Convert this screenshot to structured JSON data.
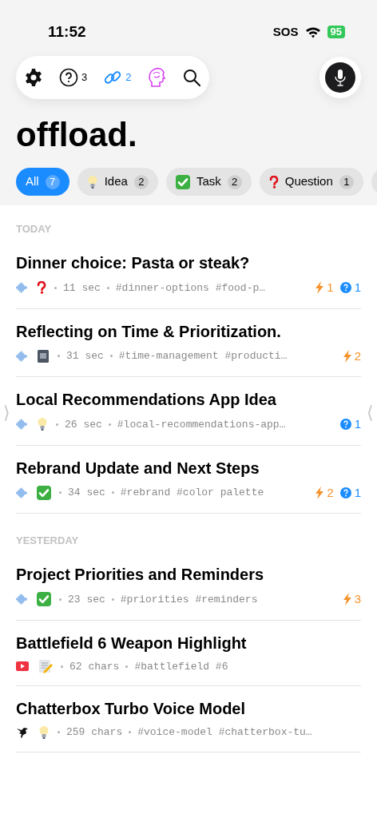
{
  "status_bar": {
    "time": "11:52",
    "carrier": "SOS",
    "battery": "95"
  },
  "toolbar": {
    "questions_count": "3",
    "links_count": "2"
  },
  "app_title": "offload.",
  "filters": [
    {
      "kind": "all",
      "label": "All",
      "count": "7",
      "selected": true
    },
    {
      "kind": "idea",
      "label": "Idea",
      "count": "2",
      "selected": false
    },
    {
      "kind": "task",
      "label": "Task",
      "count": "2",
      "selected": false
    },
    {
      "kind": "question",
      "label": "Question",
      "count": "1",
      "selected": false
    }
  ],
  "edge_markers": {
    "left": "⟩",
    "right": "⟨"
  },
  "sections": [
    {
      "heading": "TODAY",
      "notes": [
        {
          "title": "Dinner choice: Pasta or steak?",
          "source_icon": {
            "kind": "audio"
          },
          "type_icon": {
            "kind": "question"
          },
          "length": "11 sec",
          "tags": "#dinner-options #food-p…",
          "sparks": "1",
          "questions": "1"
        },
        {
          "title": "Reflecting on Time & Prioritization.",
          "source_icon": {
            "kind": "audio"
          },
          "type_icon": {
            "kind": "journal"
          },
          "length": "31 sec",
          "tags": "#time-management #producti…",
          "sparks": "2"
        },
        {
          "title": "Local Recommendations App Idea",
          "source_icon": {
            "kind": "audio"
          },
          "type_icon": {
            "kind": "idea"
          },
          "length": "26 sec",
          "tags": "#local-recommendations-app…",
          "questions": "1"
        },
        {
          "title": "Rebrand Update and Next Steps",
          "source_icon": {
            "kind": "audio"
          },
          "type_icon": {
            "kind": "task"
          },
          "length": "34 sec",
          "tags": "#rebrand #color palette",
          "sparks": "2",
          "questions": "1"
        }
      ]
    },
    {
      "heading": "YESTERDAY",
      "notes": [
        {
          "title": "Project Priorities and Reminders",
          "source_icon": {
            "kind": "audio"
          },
          "type_icon": {
            "kind": "task"
          },
          "length": "23 sec",
          "tags": "#priorities #reminders",
          "sparks": "3"
        },
        {
          "title": "Battlefield 6 Weapon Highlight",
          "source_icon": {
            "kind": "video"
          },
          "type_icon": {
            "kind": "memo"
          },
          "length": "62 chars",
          "tags": "#battlefield #6"
        },
        {
          "title": "Chatterbox Turbo Voice Model",
          "source_icon": {
            "kind": "bird"
          },
          "type_icon": {
            "kind": "idea"
          },
          "length": "259 chars",
          "tags": "#voice-model #chatterbox-tu…"
        }
      ]
    }
  ]
}
